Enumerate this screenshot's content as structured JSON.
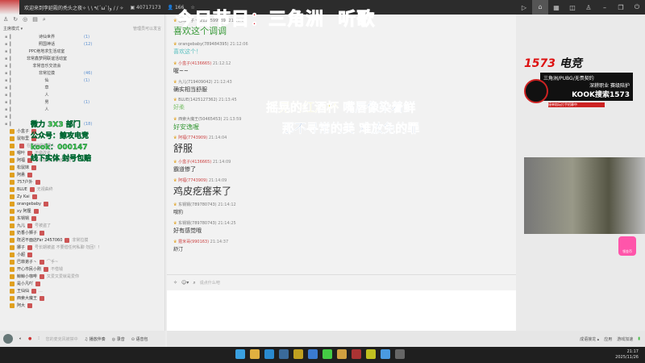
{
  "titlebar": {
    "title": "欢迎来到李延殿的秃头之夜✧ \\ \\ ٩(ˊωˋ)و / / ✧",
    "channel_id": "40717173",
    "online": "166"
  },
  "overlay": {
    "program": "今日节目：三角洲  听歌",
    "lyric1a": "摇晃的红酒杯",
    "lyric1b": " 嘴唇像染着鲜",
    "lyric2": "那不寻常的美 难放免的罪",
    "ads": [
      "微力 3X3 部门",
      "公众号：鲸攻电竞",
      "kook：000147",
      "线下实体 封号包赔"
    ]
  },
  "left": {
    "mode": "主席模式 ▾",
    "admin_note": "管理员可以发言",
    "channels": [
      {
        "name": "诗仙世界",
        "count": "(1)"
      },
      {
        "name": "照国神话",
        "count": "(12)"
      },
      {
        "name": "PPC绝地求生活动室",
        "count": ""
      },
      {
        "name": "非常鑫梦网联谊活动室",
        "count": ""
      },
      {
        "name": "非常音乐交流会",
        "count": ""
      },
      {
        "name": "非常拉摸",
        "count": "(46)"
      },
      {
        "name": "仙",
        "count": "(1)"
      },
      {
        "name": "草",
        "count": ""
      },
      {
        "name": "人",
        "count": ""
      },
      {
        "name": "男",
        "count": "(1)"
      },
      {
        "name": "人",
        "count": ""
      },
      {
        "name": "",
        "count": ""
      },
      {
        "name": "",
        "count": "(18)"
      }
    ],
    "members": [
      {
        "name": "小盒子",
        "sig": ""
      },
      {
        "name": "鼠标里",
        "sig": ""
      },
      {
        "name": "",
        "sig": "在的时候不理人"
      },
      {
        "name": "嗯叶",
        "sig": "不做改名"
      },
      {
        "name": "阿福",
        "sig": "心怀感恩，永远忠诚"
      },
      {
        "name": "松鼠妹",
        "sig": ""
      },
      {
        "name": "阿悬",
        "sig": ""
      },
      {
        "name": "757户外",
        "sig": ""
      },
      {
        "name": "BLUE",
        "sig": "无视曲终"
      },
      {
        "name": "Zy Kai",
        "sig": ""
      },
      {
        "name": "orangebaby",
        "sig": ""
      },
      {
        "name": "xy 阿狸",
        "sig": ""
      },
      {
        "name": "东锅锅",
        "sig": ""
      },
      {
        "name": "九儿",
        "sig": "号被盗了"
      },
      {
        "name": "奶香小狮子",
        "sig": ""
      },
      {
        "name": "既迟不面店Far 2457060",
        "sig": "非常拉摸"
      },
      {
        "name": "娜子",
        "sig": "号长期被盗 不要借任何私聊 勿回！！"
      },
      {
        "name": "小超",
        "sig": ""
      },
      {
        "name": "巴菲弟子丶",
        "sig": "⌒手~"
      },
      {
        "name": "开心市民小刚",
        "sig": "不借钱"
      },
      {
        "name": "鲸鲸小咖啡",
        "sig": "又爱又爱就是爱你"
      },
      {
        "name": "是小凡吖",
        "sig": ""
      },
      {
        "name": "王仙仙",
        "sig": "..."
      },
      {
        "name": "西索大魔王",
        "sig": ""
      },
      {
        "name": "阿大",
        "sig": ""
      }
    ],
    "bottom": {
      "mic_hint": "您的麦克风被禁中",
      "music": "播放伴奏",
      "record": "录音",
      "voice": "语音包"
    }
  },
  "chat": {
    "messages": [
      {
        "user": "巴菲弟子丶(2122599939)",
        "time": "21:11:57",
        "text": "喜欢这个调调",
        "color": "#3a9a3a",
        "size": 11,
        "red": false
      },
      {
        "user": "orangebaby(789484395)",
        "time": "21:12:06",
        "text": "喜欢这个！",
        "color": "#5ac0c0",
        "size": 7,
        "red": false
      },
      {
        "user": "小盒子(4136665)",
        "time": "21:12:12",
        "text": "喔~~",
        "color": "#333",
        "size": 7,
        "red": true
      },
      {
        "user": "九儿(719409042)",
        "time": "21:12:43",
        "text": "确实相当舒服",
        "color": "#333",
        "size": 7,
        "red": false
      },
      {
        "user": "BLUE(1425127362)",
        "time": "21:13:45",
        "text": "好柔",
        "color": "#7bc06a",
        "size": 7,
        "red": false
      },
      {
        "user": "西索大魔王(50465453)",
        "time": "21:13:59",
        "text": "好安逸喔",
        "color": "#3a9a3a",
        "size": 8,
        "red": false
      },
      {
        "user": "阿福(7743909)",
        "time": "21:14:04",
        "text": "舒服",
        "color": "#333",
        "size": 12,
        "red": true
      },
      {
        "user": "小盒子(4136665)",
        "time": "21:14:09",
        "text": "霸道惨了",
        "color": "#333",
        "size": 7,
        "red": true
      },
      {
        "user": "阿福(7743909)",
        "time": "21:14:09",
        "text": "鸡皮疙瘩来了",
        "color": "#333",
        "size": 12,
        "red": true
      },
      {
        "user": "东锅锅(789780743)",
        "time": "21:14:12",
        "text": "哦豹",
        "color": "#333",
        "size": 6,
        "red": false
      },
      {
        "user": "东锅锅(789780743)",
        "time": "21:14:25",
        "text": "好有感觉哦",
        "color": "#333",
        "size": 7,
        "red": false
      },
      {
        "user": "霆米哥(990163)",
        "time": "21:14:37",
        "text": "舒汀",
        "color": "#333",
        "size": 6,
        "red": true
      }
    ],
    "input_placeholder": "说点什么吧"
  },
  "promo": {
    "brand": "1573",
    "brand2": "电竞",
    "line1": "三角洲/PUBG/无畏契约",
    "line2": "深耕职业 赛级陪护",
    "line3": "KOOK搜索1573",
    "foot": "接单陪玩打手招募中",
    "gift": "领金币"
  },
  "status": {
    "items": [
      "成语接龙 ▴",
      "应用",
      "游戏加速"
    ]
  },
  "clock": {
    "time": "21:17",
    "date": "2025/11/26"
  },
  "colors": {
    "accent_red": "#e0101e",
    "green": "#4bd24b"
  }
}
